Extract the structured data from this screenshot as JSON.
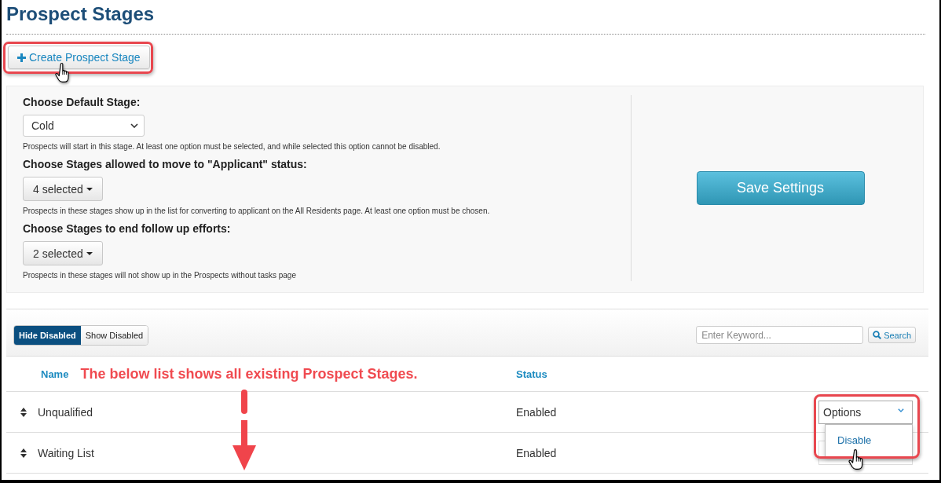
{
  "page": {
    "title": "Prospect Stages"
  },
  "create_button": {
    "label": "Create Prospect Stage",
    "highlighted": true,
    "hovered": true
  },
  "settings": {
    "fields": [
      {
        "kind": "select",
        "label": "Choose Default Stage:",
        "value": "Cold",
        "help": "Prospects will start in this stage. At least one option must be selected, and while selected this option cannot be disabled."
      },
      {
        "kind": "multiselect",
        "label": "Choose Stages allowed to move to \"Applicant\" status:",
        "value": "4 selected",
        "help": "Prospects in these stages show up in the list for converting to applicant on the All Residents page. At least one option must be chosen."
      },
      {
        "kind": "multiselect",
        "label": "Choose Stages to end follow up efforts:",
        "value": "2 selected",
        "help": "Prospects in these stages will not show up in the Prospects without tasks page"
      }
    ],
    "save_button": "Save Settings"
  },
  "toolbar": {
    "filters": [
      {
        "label": "Hide Disabled",
        "selected": true
      },
      {
        "label": "Show Disabled",
        "selected": false
      }
    ],
    "search": {
      "placeholder": "Enter Keyword...",
      "button": "Search"
    }
  },
  "table": {
    "columns": [
      "Name",
      "Status"
    ],
    "annotation": "The below list shows all existing Prospect Stages.",
    "arrow": true,
    "rows": [
      {
        "name": "Unqualified",
        "status": "Enabled",
        "options": {
          "label": "Options",
          "expanded": true,
          "highlighted": true,
          "menu": [
            {
              "label": "Disable",
              "hovered": true
            }
          ]
        }
      },
      {
        "name": "Waiting List",
        "status": "Enabled",
        "options": {
          "expanded": false,
          "highlighted": false
        }
      }
    ]
  }
}
